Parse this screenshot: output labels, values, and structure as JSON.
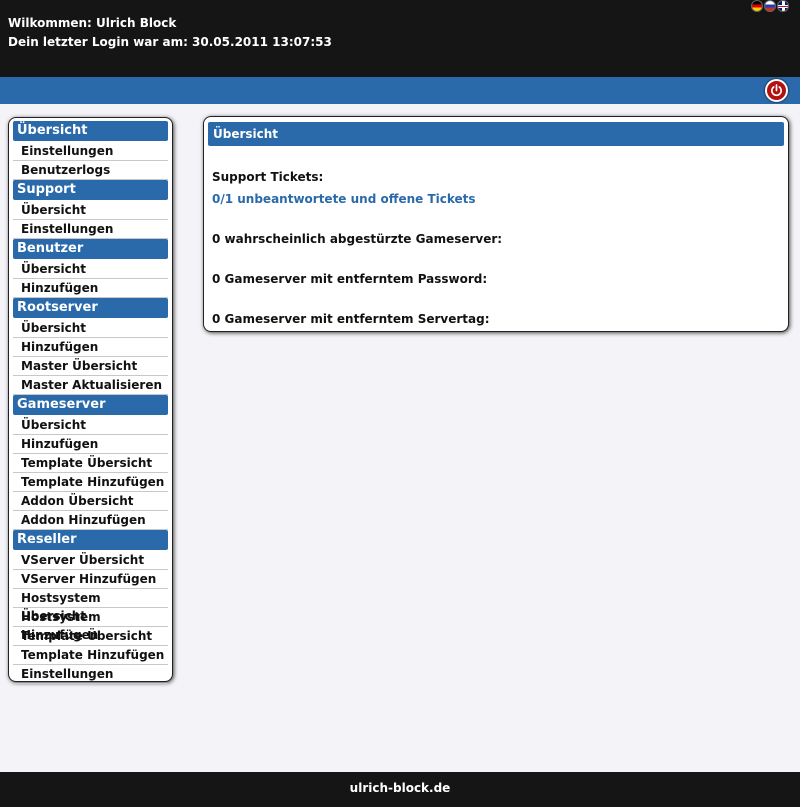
{
  "header": {
    "welcome": "Wilkommen: Ulrich Block",
    "last_login": "Dein letzter Login war am: 30.05.2011 13:07:53",
    "flags": [
      "flag-de-icon",
      "flag-ru-icon",
      "flag-gb-icon"
    ],
    "logout_icon": "power-icon"
  },
  "sidebar": {
    "sections": [
      {
        "title": "Übersicht",
        "items": [
          "Einstellungen",
          "Benutzerlogs"
        ]
      },
      {
        "title": "Support",
        "items": [
          "Übersicht",
          "Einstellungen"
        ]
      },
      {
        "title": "Benutzer",
        "items": [
          "Übersicht",
          "Hinzufügen"
        ]
      },
      {
        "title": "Rootserver",
        "items": [
          "Übersicht",
          "Hinzufügen",
          "Master Übersicht",
          "Master Aktualisieren"
        ]
      },
      {
        "title": "Gameserver",
        "items": [
          "Übersicht",
          "Hinzufügen",
          "Template Übersicht",
          "Template Hinzufügen",
          "Addon Übersicht",
          "Addon Hinzufügen"
        ]
      },
      {
        "title": "Reseller",
        "items": [
          "VServer Übersicht",
          "VServer Hinzufügen",
          "Hostsystem Übersicht",
          "Hostsystem Hinzufügen",
          "Template Übersicht",
          "Template Hinzufügen",
          "Einstellungen"
        ]
      }
    ]
  },
  "main": {
    "title": "Übersicht",
    "support_label": "Support Tickets:",
    "tickets_link": "0/1 unbeantwortete und offene Tickets",
    "crashed": "0 wahrscheinlich abgestürzte Gameserver:",
    "removed_password": "0 Gameserver mit entferntem Password:",
    "removed_servertag": "0 Gameserver mit entferntem Servertag:"
  },
  "footer": {
    "text": "ulrich-block.de"
  },
  "colors": {
    "accent": "#2a6aab",
    "dark": "#151515",
    "logout": "#b31010"
  }
}
